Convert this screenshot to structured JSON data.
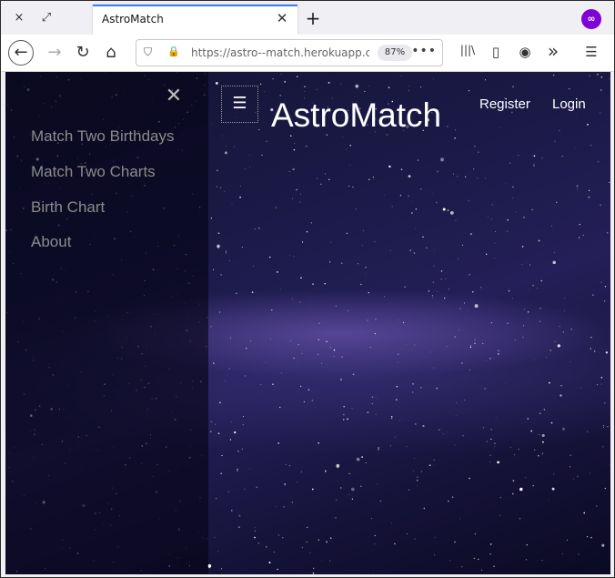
{
  "browser": {
    "tab_title": "AstroMatch",
    "url": "https://astro--match.herokuapp.com",
    "zoom": "87%",
    "icons": {
      "close_window": "×",
      "restore": "⤢",
      "tab_close": "✕",
      "new_tab": "+",
      "private": "∞",
      "back": "←",
      "forward": "→",
      "reload": "↻",
      "home": "⌂",
      "shield": "⛉",
      "lock": "🔒",
      "more": "•••",
      "library": "|||\\",
      "sidebar": "▯",
      "account": "◉",
      "overflow": "»",
      "menu": "☰"
    }
  },
  "app": {
    "brand": "AstroMatch",
    "menu_icon": "☰",
    "close_icon": "✕",
    "nav_links": [
      "Register",
      "Login"
    ],
    "sidebar_items": [
      "Match Two Birthdays",
      "Match Two Charts",
      "Birth Chart",
      "About"
    ]
  }
}
